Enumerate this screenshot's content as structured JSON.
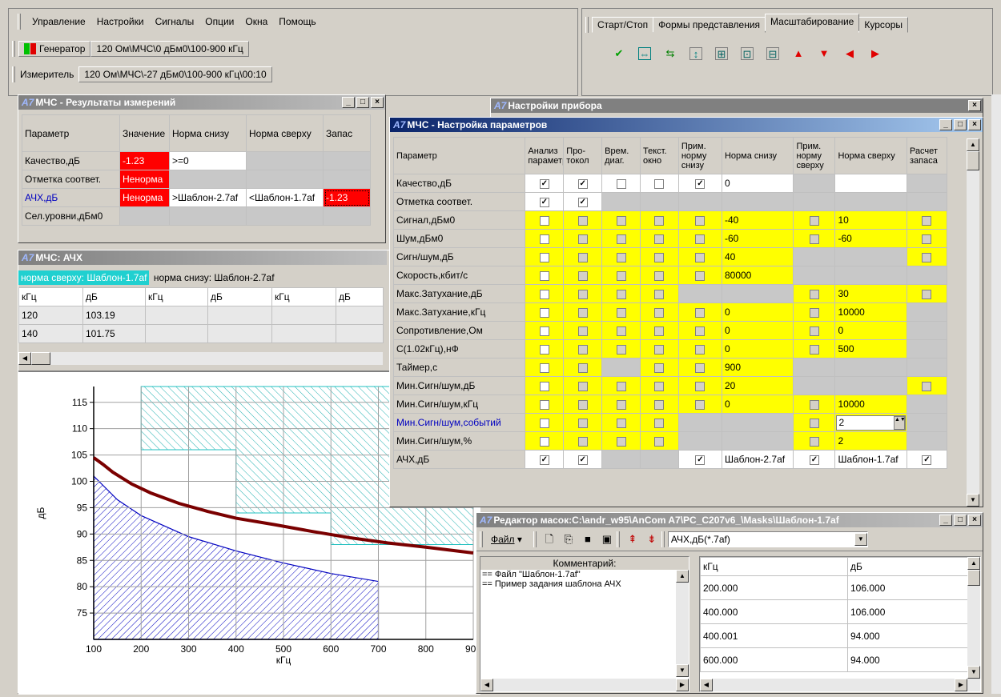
{
  "menu": [
    "Управление",
    "Настройки",
    "Сигналы",
    "Опции",
    "Окна",
    "Помощь"
  ],
  "generator": {
    "label": "Генератор",
    "value": "120 Ом\\МЧС\\0 дБм0\\100-900 кГц"
  },
  "meter": {
    "label": "Измеритель",
    "value": "120 Ом\\МЧС\\-27 дБм0\\100-900 кГц\\00:10"
  },
  "tabs": [
    "Старт/Стоп",
    "Формы представления",
    "Масштабирование",
    "Курсоры"
  ],
  "zoom_icons": [
    "pen-icon",
    "fit-both-icon",
    "fit-x-icon",
    "fit-y-icon",
    "zoom-in-icon",
    "zoom-box-icon",
    "zoom-out-icon",
    "arrow-up-icon",
    "arrow-down-icon",
    "arrow-left-icon",
    "arrow-right-icon"
  ],
  "results": {
    "title": "МЧС - Результаты измерений",
    "headers": [
      "Параметр",
      "Значение",
      "Норма снизу",
      "Норма сверху",
      "Запас"
    ],
    "rows": [
      {
        "p": "Качество,дБ",
        "v": "-1.23",
        "lo": ">=0",
        "hi": "",
        "z": ""
      },
      {
        "p": "Отметка соответ.",
        "v": "Ненорма",
        "lo": "",
        "hi": "",
        "z": ""
      },
      {
        "p": "АЧХ,дБ",
        "v": "Ненорма",
        "lo": ">Шаблон-2.7af",
        "hi": "<Шаблон-1.7af",
        "z": "-1.23"
      },
      {
        "p": "Сел.уровни,дБм0",
        "v": "",
        "lo": "",
        "hi": "",
        "z": ""
      }
    ]
  },
  "ach": {
    "title": "МЧС: АЧХ",
    "legend_hi": "норма сверху: Шаблон-1.7af",
    "legend_lo": "норма снизу: Шаблон-2.7af",
    "headers": [
      "кГц",
      "дБ",
      "кГц",
      "дБ",
      "кГц",
      "дБ"
    ],
    "rows": [
      [
        "120",
        "103.19"
      ],
      [
        "140",
        "101.75"
      ]
    ]
  },
  "chart_data": {
    "type": "line",
    "xlabel": "кГц",
    "ylabel": "дБ",
    "xlim": [
      100,
      900
    ],
    "ylim": [
      70,
      118
    ],
    "xticks": [
      100,
      200,
      300,
      400,
      500,
      600,
      700,
      800,
      900
    ],
    "yticks": [
      75,
      80,
      85,
      90,
      95,
      100,
      105,
      110,
      115
    ],
    "grid": true,
    "measured": {
      "x": [
        100,
        120,
        140,
        180,
        220,
        280,
        340,
        400,
        480,
        560,
        640,
        720,
        800,
        900
      ],
      "y": [
        104.5,
        103.19,
        101.75,
        99.5,
        97.8,
        95.8,
        94.3,
        93.0,
        91.8,
        90.5,
        89.3,
        88.3,
        87.5,
        86.4
      ]
    },
    "lower_mask": {
      "x": [
        100,
        150,
        200,
        300,
        400,
        500,
        600,
        700,
        700
      ],
      "y": [
        101,
        96.5,
        93.5,
        89.5,
        86.8,
        84.5,
        82.5,
        81.0,
        70
      ]
    },
    "upper_mask": {
      "x": [
        200,
        200,
        400,
        400,
        600,
        600,
        900,
        900
      ],
      "y": [
        118,
        106,
        106,
        94,
        94,
        88,
        88,
        118
      ]
    }
  },
  "settings_outer": {
    "title": "Настройки прибора"
  },
  "params": {
    "title": "МЧС - Настройка параметров",
    "headers": [
      "Параметр",
      "Анализ параметр",
      "Про-токол",
      "Врем. диаг.",
      "Текст. окно",
      "Прим. норму снизу",
      "Норма снизу",
      "Прим. норму сверху",
      "Норма сверху",
      "Расчет запаса"
    ],
    "rows": [
      {
        "p": "Качество,дБ",
        "blue": false,
        "y": false,
        "c": [
          [
            "on",
            "on",
            "off",
            "off",
            "on"
          ],
          "0",
          [
            "g"
          ],
          "",
          [
            "g"
          ]
        ]
      },
      {
        "p": "Отметка соответ.",
        "blue": false,
        "y": false,
        "c": [
          [
            "on",
            "on",
            "g",
            "g",
            "g"
          ],
          "g",
          [
            "g"
          ],
          "g",
          [
            "g"
          ]
        ]
      },
      {
        "p": "Сигнал,дБм0",
        "blue": false,
        "y": true,
        "c": [
          [
            "off",
            "dis",
            "dis",
            "dis",
            "dis"
          ],
          "-40",
          [
            "dis"
          ],
          "10",
          [
            "dis"
          ]
        ]
      },
      {
        "p": "Шум,дБм0",
        "blue": false,
        "y": true,
        "c": [
          [
            "off",
            "dis",
            "dis",
            "dis",
            "dis"
          ],
          "-60",
          [
            "dis"
          ],
          "-60",
          [
            "dis"
          ]
        ]
      },
      {
        "p": "Сигн/шум,дБ",
        "blue": false,
        "y": true,
        "c": [
          [
            "off",
            "dis",
            "dis",
            "dis",
            "dis"
          ],
          "40",
          [
            "g"
          ],
          "g",
          [
            "dis"
          ]
        ]
      },
      {
        "p": "Скорость,кбит/с",
        "blue": false,
        "y": true,
        "c": [
          [
            "off",
            "dis",
            "dis",
            "dis",
            "dis"
          ],
          "80000",
          [
            "g"
          ],
          "g",
          [
            "g"
          ]
        ]
      },
      {
        "p": "Макс.Затухание,дБ",
        "blue": false,
        "y": true,
        "c": [
          [
            "off",
            "dis",
            "dis",
            "dis",
            "g"
          ],
          "g",
          [
            "dis"
          ],
          "30",
          [
            "dis"
          ]
        ]
      },
      {
        "p": "Макс.Затухание,кГц",
        "blue": false,
        "y": true,
        "c": [
          [
            "off",
            "dis",
            "dis",
            "dis",
            "dis"
          ],
          "0",
          [
            "dis"
          ],
          "10000",
          [
            "g"
          ]
        ]
      },
      {
        "p": "Сопротивление,Ом",
        "blue": false,
        "y": true,
        "c": [
          [
            "off",
            "dis",
            "dis",
            "dis",
            "dis"
          ],
          "0",
          [
            "dis"
          ],
          "0",
          [
            "g"
          ]
        ]
      },
      {
        "p": "С(1.02кГц),нФ",
        "blue": false,
        "y": true,
        "c": [
          [
            "off",
            "dis",
            "dis",
            "dis",
            "dis"
          ],
          "0",
          [
            "dis"
          ],
          "500",
          [
            "g"
          ]
        ]
      },
      {
        "p": "Таймер,с",
        "blue": false,
        "y": true,
        "c": [
          [
            "off",
            "dis",
            "g",
            "dis",
            "dis"
          ],
          "900",
          [
            "g"
          ],
          "g",
          [
            "g"
          ]
        ]
      },
      {
        "p": "Мин.Сигн/шум,дБ",
        "blue": false,
        "y": true,
        "c": [
          [
            "off",
            "dis",
            "dis",
            "dis",
            "dis"
          ],
          "20",
          [
            "g"
          ],
          "g",
          [
            "dis"
          ]
        ]
      },
      {
        "p": "Мин.Сигн/шум,кГц",
        "blue": false,
        "y": true,
        "c": [
          [
            "off",
            "dis",
            "dis",
            "dis",
            "dis"
          ],
          "0",
          [
            "dis"
          ],
          "10000",
          [
            "g"
          ]
        ]
      },
      {
        "p": "Мин.Сигн/шум,событий",
        "blue": true,
        "y": true,
        "c": [
          [
            "off",
            "dis",
            "dis",
            "dis",
            "g"
          ],
          "g",
          [
            "dis"
          ],
          "2",
          [
            "g"
          ]
        ]
      },
      {
        "p": "Мин.Сигн/шум,%",
        "blue": false,
        "y": true,
        "c": [
          [
            "off",
            "dis",
            "dis",
            "dis",
            "g"
          ],
          "g",
          [
            "dis"
          ],
          "2",
          [
            "g"
          ]
        ]
      },
      {
        "p": "АЧХ,дБ",
        "blue": false,
        "y": false,
        "c": [
          [
            "on",
            "on",
            "g",
            "g",
            "on"
          ],
          "Шаблон-2.7af",
          [
            "on"
          ],
          "Шаблон-1.7af",
          [
            "on"
          ]
        ]
      }
    ]
  },
  "mask_editor": {
    "title": "Редактор масок:C:\\andr_w95\\AnCom A7\\PC_C207v6_\\Masks\\Шаблон-1.7af",
    "file_menu": "Файл",
    "combo": "АЧХ,дБ(*.7af)",
    "comment_header": "Комментарий:",
    "comments": [
      "== Файл \"Шаблон-1.7af\"",
      "== Пример задания шаблона АЧХ"
    ],
    "table_headers": [
      "кГц",
      "дБ"
    ],
    "table_rows": [
      [
        "200.000",
        "106.000"
      ],
      [
        "400.000",
        "106.000"
      ],
      [
        "400.001",
        "94.000"
      ],
      [
        "600.000",
        "94.000"
      ]
    ]
  }
}
